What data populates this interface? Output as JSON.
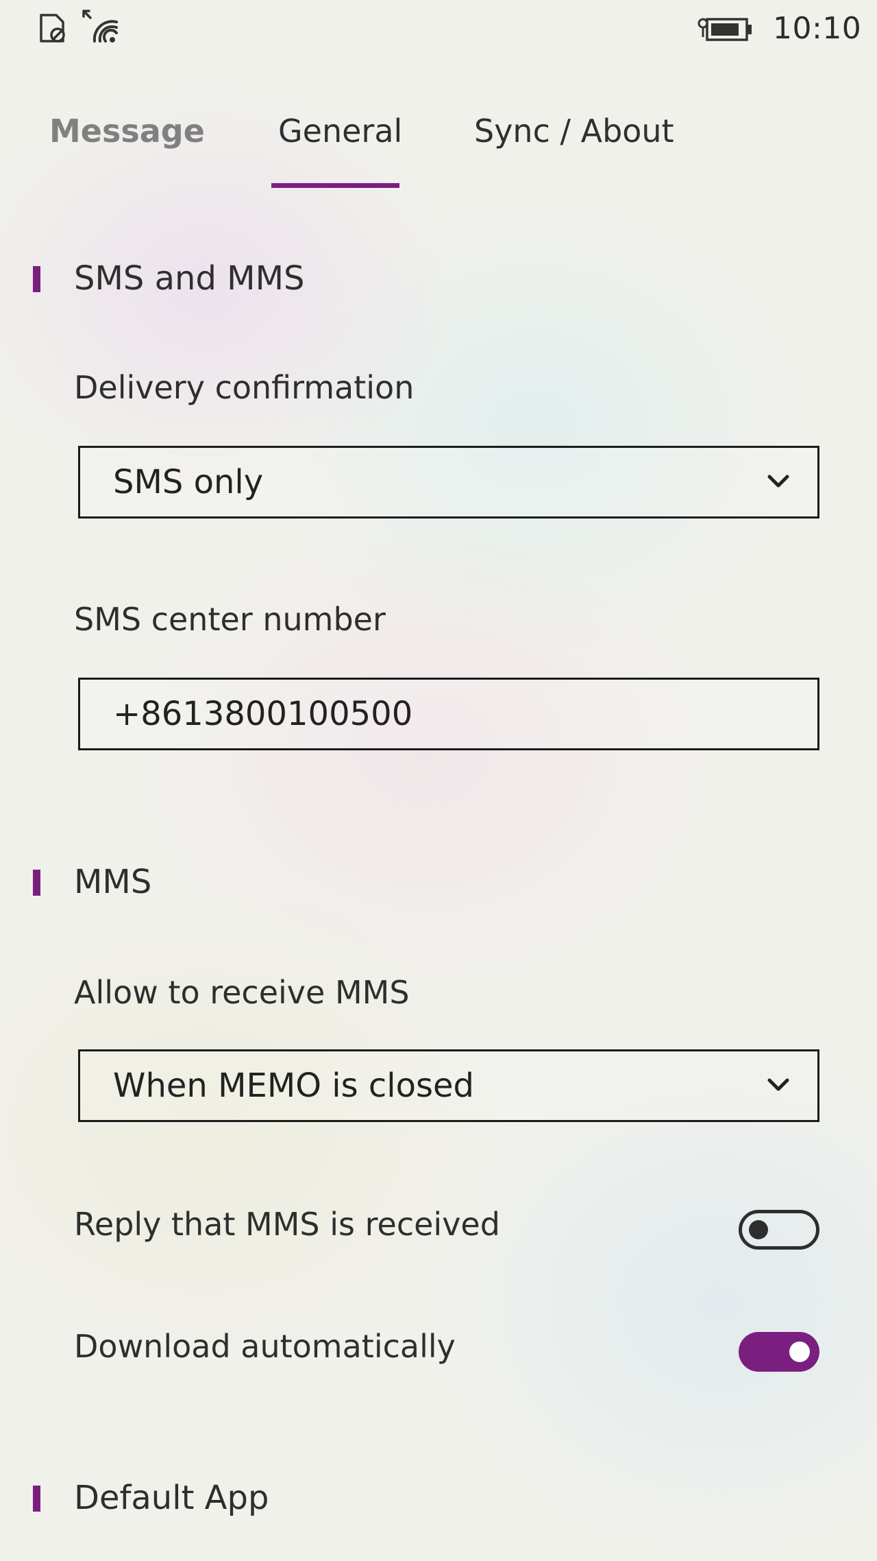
{
  "status_bar": {
    "time": "10:10",
    "icons": [
      "sim-icon",
      "signal-icon",
      "battery-icon"
    ]
  },
  "tabs": [
    {
      "label": "Message",
      "selected": false
    },
    {
      "label": "General",
      "selected": true
    },
    {
      "label": "Sync / About",
      "selected": false
    }
  ],
  "sections": {
    "sms_mms": {
      "title": "SMS and MMS",
      "delivery_confirmation": {
        "label": "Delivery confirmation",
        "value": "SMS only"
      },
      "sms_center": {
        "label": "SMS center number",
        "value": "+8613800100500"
      }
    },
    "mms": {
      "title": "MMS",
      "allow_receive": {
        "label": "Allow to receive MMS",
        "value": "When MEMO is closed"
      },
      "reply_received": {
        "label": "Reply that MMS is received",
        "on": false
      },
      "download_auto": {
        "label": "Download automatically",
        "on": true
      }
    },
    "default_app": {
      "title": "Default App"
    }
  },
  "colors": {
    "accent": "#7a1f80",
    "text": "#2e2e2e",
    "inactive_tab": "#808080"
  }
}
